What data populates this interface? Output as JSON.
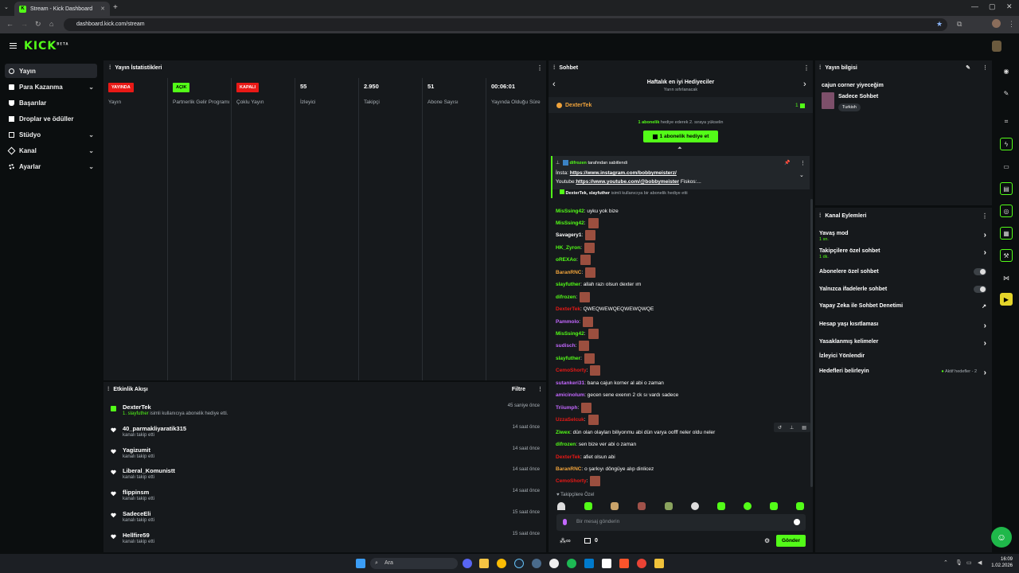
{
  "browser": {
    "tab_title": "Stream - Kick Dashboard",
    "url": "dashboard.kick.com/stream"
  },
  "header": {
    "logo": "KICK",
    "logo_sup": "BETA"
  },
  "sidebar": {
    "items": [
      {
        "label": "Yayın"
      },
      {
        "label": "Para Kazanma"
      },
      {
        "label": "Başarılar"
      },
      {
        "label": "Droplar ve ödüller"
      },
      {
        "label": "Stüdyo"
      },
      {
        "label": "Kanal"
      },
      {
        "label": "Ayarlar"
      }
    ]
  },
  "stats": {
    "title": "Yayın İstatistikleri",
    "cols": [
      {
        "value": "YAYINDA",
        "label": "Yayın"
      },
      {
        "value": "AÇIK",
        "label": "Partnerlik Gelir Programı"
      },
      {
        "value": "KAPALI",
        "label": "Çoklu Yayın"
      },
      {
        "value": "55",
        "label": "İzleyici"
      },
      {
        "value": "2.950",
        "label": "Takipçi"
      },
      {
        "value": "51",
        "label": "Abone Sayısı"
      },
      {
        "value": "00:06:01",
        "label": "Yayında Olduğu Süre"
      }
    ]
  },
  "events": {
    "title": "Etkinlik Akışı",
    "filter": "Filtre",
    "items": [
      {
        "name": "DexterTek",
        "sub_user": "1. slayfuther",
        "sub": " isimli kullanıcıya abonelik hediye etti.",
        "time": "45 saniye önce"
      },
      {
        "name": "40_parmakliyaratik315",
        "sub_user": "",
        "sub": "kanalı takip etti",
        "time": "14 saat önce"
      },
      {
        "name": "Yagizumit",
        "sub_user": "",
        "sub": "kanalı takip etti",
        "time": "14 saat önce"
      },
      {
        "name": "Liberal_Komunistt",
        "sub_user": "",
        "sub": "kanalı takip etti",
        "time": "14 saat önce"
      },
      {
        "name": "flippinsm",
        "sub_user": "",
        "sub": "kanalı takip etti",
        "time": "14 saat önce"
      },
      {
        "name": "SadeceEli",
        "sub_user": "",
        "sub": "kanalı takip etti",
        "time": "15 saat önce"
      },
      {
        "name": "Hellfire59",
        "sub_user": "",
        "sub": "kanalı takip etti",
        "time": "15 saat önce"
      }
    ]
  },
  "chat": {
    "title": "Sohbet",
    "leaderboard_title": "Haftalık en iyi Hediyeciler",
    "leaderboard_sub": "Yarın sıfırlanacak",
    "top_gifter": "DexterTek",
    "top_gifter_count": "1",
    "gift_hint_bold": "1 abonelik",
    "gift_hint": " hediye ederek 2. sıraya yükselin",
    "gift_button": "1 abonelik hediye et",
    "pinned_by_user": "difrozen",
    "pinned_by_text": " tarafından sabitlendi",
    "pinned_line1_label": "İnsta: ",
    "pinned_line1_link": "https://www.instagram.com/bobbymeisterz/",
    "pinned_line2_label": "Youtube:",
    "pinned_line2_link": "https://www.youtube.com/@bobbymeister",
    "pinned_line2_rest": " Fiskos:...",
    "gift_notice_users": "DexterTek, slayfuther",
    "gift_notice_text": " isimli kullanıcıya bir abonelik hediye etti",
    "messages": [
      {
        "user": "MisSsing42",
        "text": ": uyku yok bize",
        "color": "#53fc18",
        "emote": false
      },
      {
        "user": "MisSsing42",
        "text": ":",
        "color": "#53fc18",
        "emote": true
      },
      {
        "user": "Savagery1",
        "text": ":",
        "color": "#ffffff",
        "emote": true
      },
      {
        "user": "HK_Zyron",
        "text": ":",
        "color": "#53fc18",
        "emote": true
      },
      {
        "user": "oREXAo",
        "text": ":",
        "color": "#53fc18",
        "emote": true
      },
      {
        "user": "BaranRNC",
        "text": ":",
        "color": "#f0a33b",
        "emote": true
      },
      {
        "user": "slayfuther",
        "text": ": allah razı olsun dexter ım",
        "color": "#53fc18",
        "emote": false
      },
      {
        "user": "difrozen",
        "text": ":",
        "color": "#53fc18",
        "emote": true
      },
      {
        "user": "DexterTek",
        "text": ": QWEQWEWQEQWEWQWQE",
        "color": "#e91916",
        "emote": false
      },
      {
        "user": "Pammolo",
        "text": ":",
        "color": "#c368ff",
        "emote": true
      },
      {
        "user": "MisSsing42",
        "text": ":",
        "color": "#53fc18",
        "emote": true
      },
      {
        "user": "sudisch",
        "text": ":",
        "color": "#c368ff",
        "emote": true
      },
      {
        "user": "slayfuther",
        "text": ":",
        "color": "#53fc18",
        "emote": true
      },
      {
        "user": "CemoShorty",
        "text": ":",
        "color": "#e91916",
        "emote": true
      },
      {
        "user": "sutankeri31",
        "text": ": bana cajun korner al abi o zaman",
        "color": "#c368ff",
        "emote": false
      },
      {
        "user": "amicinolum",
        "text": ": gecen sene exenın 2 ck sı vardı sadece",
        "color": "#c368ff",
        "emote": false
      },
      {
        "user": "Triiumph",
        "text": ":",
        "color": "#c368ff",
        "emote": true
      },
      {
        "user": "UzzaSelcuk",
        "text": ":",
        "color": "#e91916",
        "emote": true
      },
      {
        "user": "Ziwex",
        "text": ": dün olan olayları biliyonmu abi dün varya oofff neler oldu neler",
        "color": "#53fc18",
        "emote": false
      },
      {
        "user": "difrozen",
        "text": ": sen bize ver abi o zaman",
        "color": "#53fc18",
        "emote": false
      },
      {
        "user": "DexterTek",
        "text": ": afiet olsun abi",
        "color": "#e91916",
        "emote": false
      },
      {
        "user": "BaranRNC",
        "text": ": o şarkıyı döngüye alıp dinlicez",
        "color": "#f0a33b",
        "emote": false
      },
      {
        "user": "CemoShorty",
        "text": ":",
        "color": "#e91916",
        "emote": true
      }
    ],
    "followers_only_label": "Takipçilere Özel",
    "input_placeholder": "Bir mesaj gönderin",
    "points": "0",
    "send_button": "Gönder"
  },
  "stream_info": {
    "title": "Yayın bilgisi",
    "stream_title": "cajun corner yiyeceğim",
    "category": "Sadece Sohbet",
    "language": "Turkish"
  },
  "channel_actions": {
    "title": "Kanal Eylemleri",
    "items": [
      {
        "label": "Yavaş mod",
        "sub": "1 sn.",
        "control": "arrow"
      },
      {
        "label": "Takipçilere özel sohbet",
        "sub": "1 dk.",
        "control": "arrow"
      },
      {
        "label": "Abonelere özel sohbet",
        "sub": "",
        "control": "toggle"
      },
      {
        "label": "Yalnızca ifadelerle sohbet",
        "sub": "",
        "control": "toggle"
      },
      {
        "label": "Yapay Zeka ile Sohbet Denetimi",
        "sub": "",
        "control": "external"
      },
      {
        "label": "Hesap yaşı kısıtlaması",
        "sub": "",
        "control": "arrow"
      },
      {
        "label": "Yasaklanmış kelimeler",
        "sub": "",
        "control": "arrow"
      },
      {
        "label": "İzleyici Yönlendir",
        "sub": "",
        "control": "none"
      },
      {
        "label": "Hedefleri belirleyin",
        "sub": "",
        "control": "arrow"
      }
    ],
    "goals_status": "Aktif hedefler - 2"
  },
  "taskbar": {
    "search": "Ara",
    "time": "16:09",
    "date": "1.02.2026"
  },
  "colors": {
    "accent": "#53fc18",
    "live_red": "#e91916",
    "panel": "#16191c",
    "background": "#0b0e0f"
  }
}
